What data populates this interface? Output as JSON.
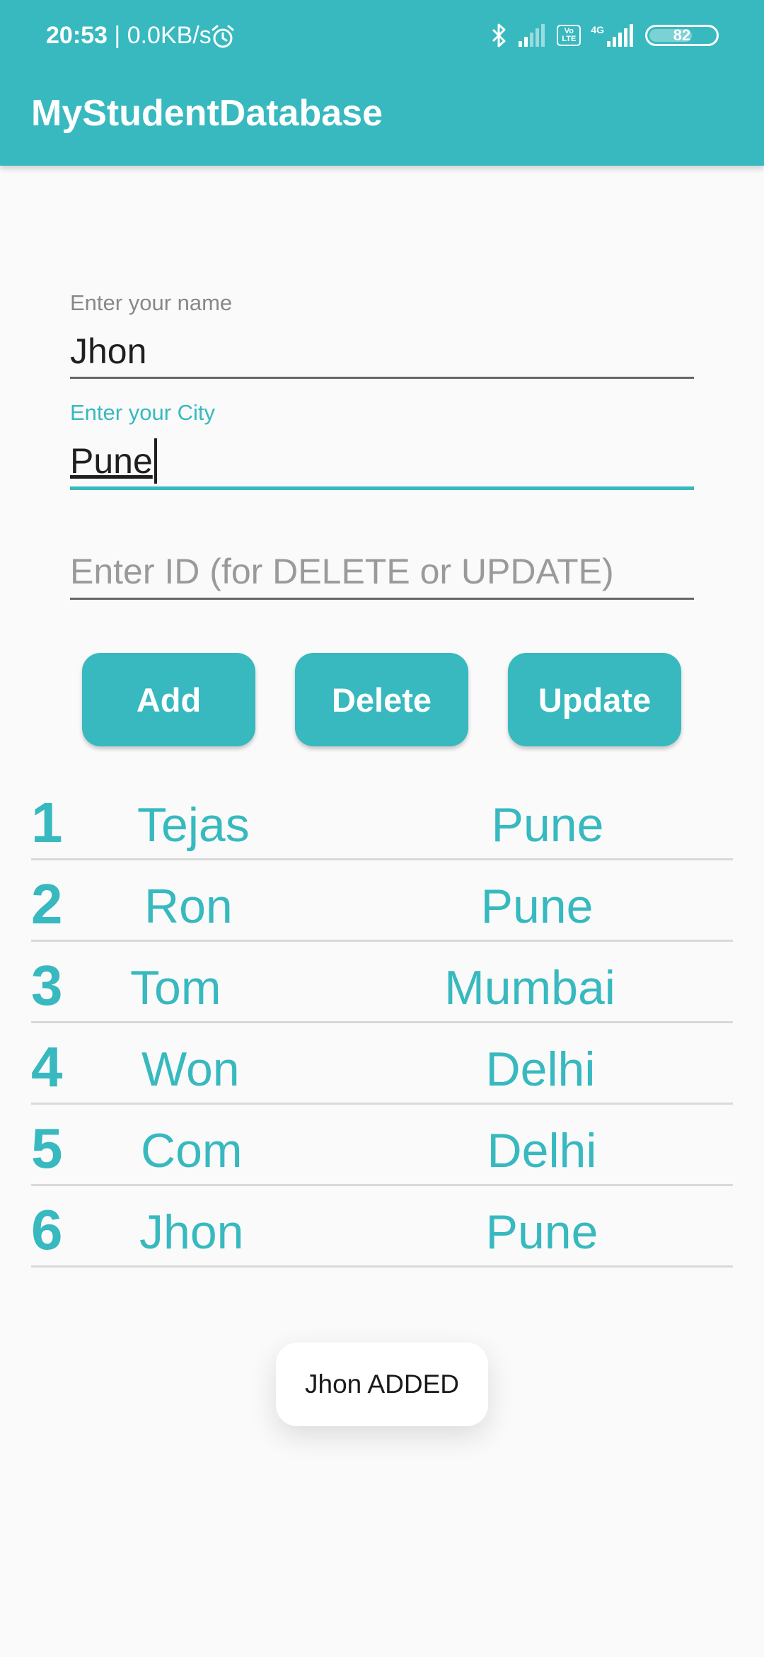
{
  "status_bar": {
    "time": "20:53",
    "speed": "| 0.0KB/s",
    "network_badge": "4G",
    "volte_badge": "Vo LTE",
    "battery": "82"
  },
  "app_bar": {
    "title": "MyStudentDatabase"
  },
  "form": {
    "name_label": "Enter your name",
    "name_value": "Jhon",
    "city_label": "Enter your City",
    "city_value": "Pune",
    "id_placeholder": "Enter ID (for DELETE or UPDATE)"
  },
  "buttons": {
    "add": "Add",
    "delete": "Delete",
    "update": "Update"
  },
  "students": [
    {
      "id": "1",
      "name": "Tejas",
      "city": "Pune"
    },
    {
      "id": "2",
      "name": "Ron",
      "city": "Pune"
    },
    {
      "id": "3",
      "name": "Tom",
      "city": "Mumbai"
    },
    {
      "id": "4",
      "name": "Won",
      "city": "Delhi"
    },
    {
      "id": "5",
      "name": "Com",
      "city": "Delhi"
    },
    {
      "id": "6",
      "name": "Jhon",
      "city": "Pune"
    }
  ],
  "toast": {
    "message": "Jhon ADDED"
  },
  "colors": {
    "accent": "#37b9bf",
    "background": "#fafafa"
  },
  "icons": {
    "alarm": "alarm-clock-icon",
    "bluetooth": "bluetooth-icon",
    "signal": "signal-strength-icon",
    "battery": "battery-icon"
  }
}
